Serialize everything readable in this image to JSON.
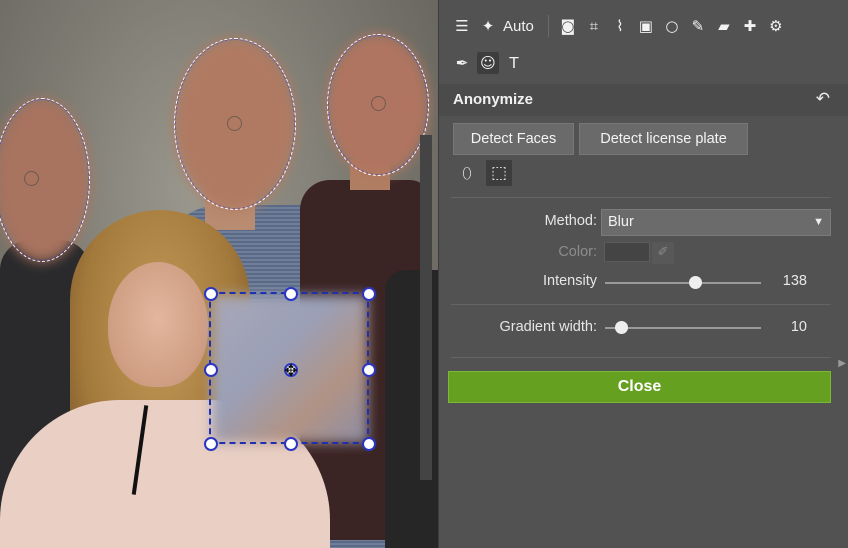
{
  "photo": {
    "selection_handles": [
      "top-left",
      "top-center",
      "top-right",
      "middle-left",
      "center",
      "middle-right",
      "bottom-left",
      "bottom-center",
      "bottom-right"
    ]
  },
  "toolbar": {
    "row1": [
      {
        "name": "adjustments-icon",
        "glyph": "☰"
      },
      {
        "name": "magic-wand-icon",
        "glyph": "✦"
      },
      {
        "name": "auto-label",
        "text": "Auto"
      },
      {
        "name": "camera-icon",
        "glyph": "◙"
      },
      {
        "name": "crop-icon",
        "glyph": "⌗"
      },
      {
        "name": "perspective-icon",
        "glyph": "⌇"
      },
      {
        "name": "text-box-icon",
        "glyph": "▣"
      },
      {
        "name": "circle-icon",
        "glyph": "○"
      },
      {
        "name": "brush-icon",
        "glyph": "✎"
      },
      {
        "name": "eraser-icon",
        "glyph": "▰"
      },
      {
        "name": "bandage-icon",
        "glyph": "✚"
      },
      {
        "name": "gear-icon",
        "glyph": "⚙"
      }
    ],
    "row2": [
      {
        "name": "pen-icon",
        "glyph": "✒"
      },
      {
        "name": "anonymize-mask-icon",
        "glyph": "☺",
        "active": true
      },
      {
        "name": "text-tool-icon",
        "glyph": "T"
      }
    ],
    "auto_label": "Auto"
  },
  "section": {
    "title": "Anonymize",
    "undo_glyph": "↶"
  },
  "buttons": {
    "detect_faces": "Detect Faces",
    "detect_plate": "Detect license plate",
    "close": "Close"
  },
  "shape_tools": {
    "ellipse_glyph": "⬯",
    "rect_glyph": "⬚"
  },
  "settings": {
    "method_label": "Method:",
    "method_value": "Blur",
    "color_label": "Color:",
    "intensity_label": "Intensity",
    "intensity_value": "138",
    "intensity_fraction": 0.58,
    "gradient_label": "Gradient width:",
    "gradient_value": "10",
    "gradient_fraction": 0.1
  }
}
